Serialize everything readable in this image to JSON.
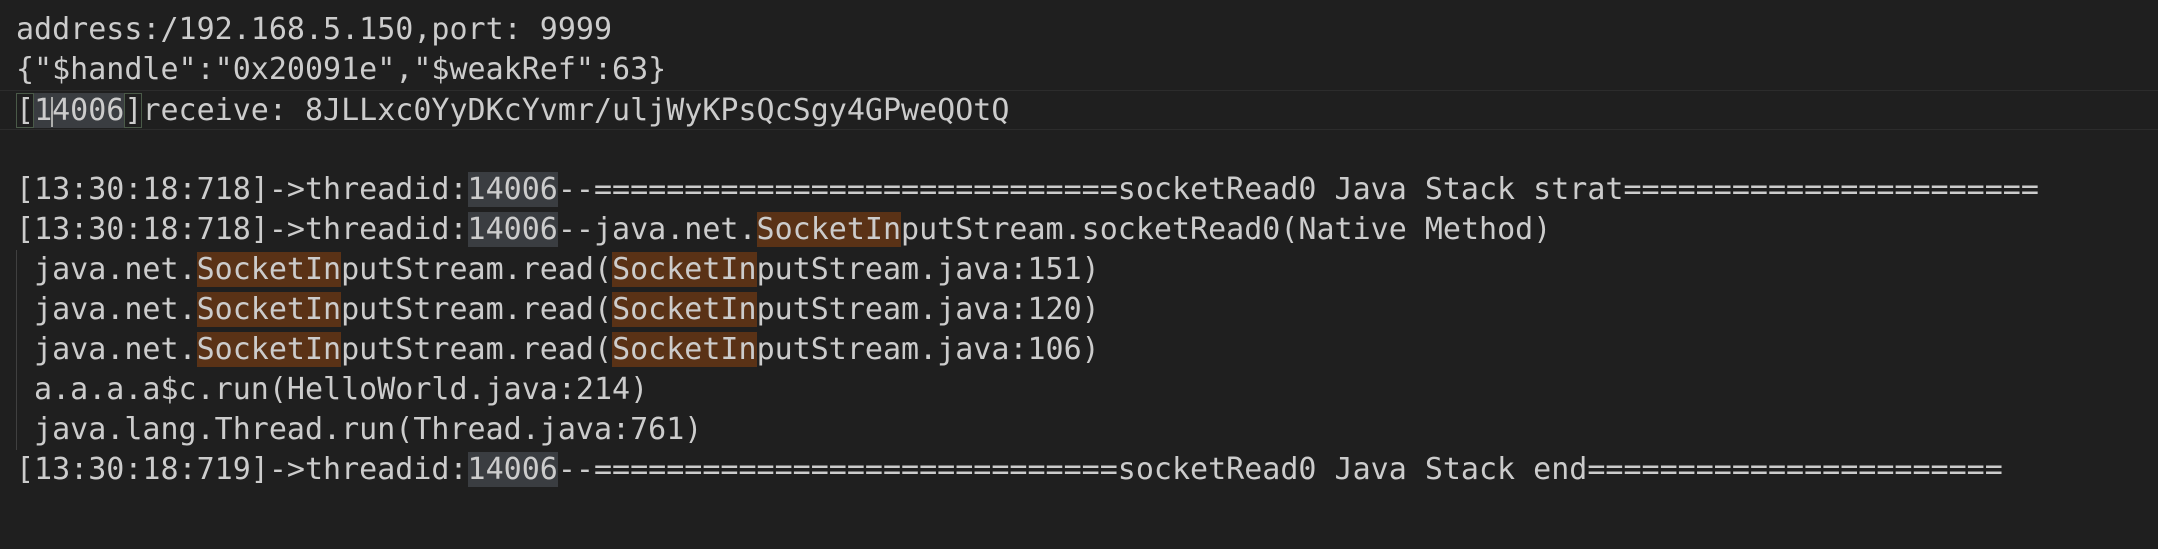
{
  "editor": {
    "lines": {
      "l1": "address:/192.168.5.150,port: 9999",
      "l2": "{\"$handle\":\"0x20091e\",\"$weakRef\":63}",
      "l3": {
        "open": "[",
        "id_a": "1",
        "id_b": "4006",
        "close": "]",
        "rest": "receive: 8JLLxc0YyDKcYvmr/uljWyKPsQcSgy4GPweQOtQ"
      },
      "l5": {
        "prefix": "[13:30:18:718]->threadid:",
        "tid": "14006",
        "rest": "--=============================socketRead0 Java Stack strat======================="
      },
      "l6": {
        "prefix": "[13:30:18:718]->threadid:",
        "tid": "14006",
        "mid": "--java.net.",
        "match": "SocketIn",
        "rest": "putStream.socketRead0(Native Method)"
      },
      "l7": {
        "pre": " java.net.",
        "match1": "SocketIn",
        "mid": "putStream.read(",
        "match2": "SocketIn",
        "rest": "putStream.java:151)"
      },
      "l8": {
        "pre": " java.net.",
        "match1": "SocketIn",
        "mid": "putStream.read(",
        "match2": "SocketIn",
        "rest": "putStream.java:120)"
      },
      "l9": {
        "pre": " java.net.",
        "match1": "SocketIn",
        "mid": "putStream.read(",
        "match2": "SocketIn",
        "rest": "putStream.java:106)"
      },
      "l10": " a.a.a.a$c.run(HelloWorld.java:214)",
      "l11": " java.lang.Thread.run(Thread.java:761)",
      "l12": {
        "prefix": "[13:30:18:719]->threadid:",
        "tid": "14006",
        "rest": "--=============================socketRead0 Java Stack end======================="
      }
    }
  },
  "colors": {
    "background": "#1f1f1f",
    "text": "#cccccc",
    "selection_highlight": "#3a3d41",
    "find_match": "#5a3216"
  }
}
